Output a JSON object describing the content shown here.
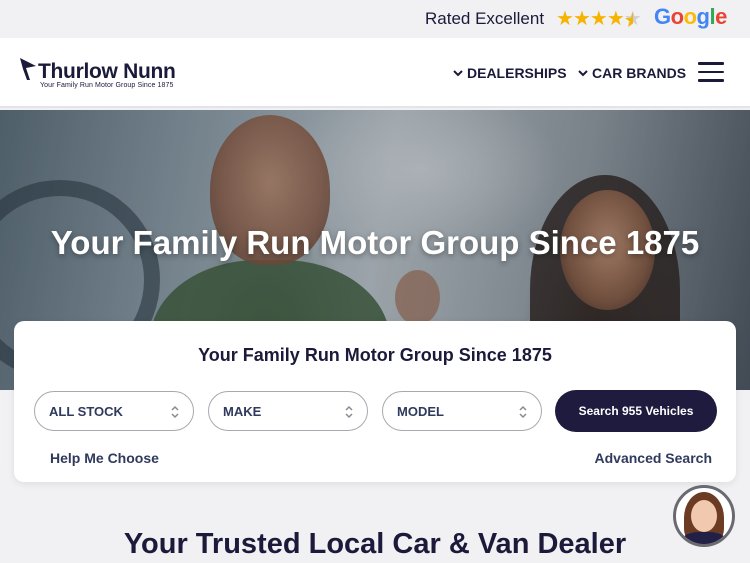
{
  "rating": {
    "label": "Rated Excellent",
    "stars_filled": 4.5,
    "stars_total": 5,
    "provider": "Google",
    "provider_letters": [
      {
        "char": "G",
        "color": "#4285F4"
      },
      {
        "char": "o",
        "color": "#EA4335"
      },
      {
        "char": "o",
        "color": "#FBBC05"
      },
      {
        "char": "g",
        "color": "#4285F4"
      },
      {
        "char": "l",
        "color": "#34A853"
      },
      {
        "char": "e",
        "color": "#EA4335"
      }
    ]
  },
  "header": {
    "logo_name": "Thurlow Nunn",
    "logo_tagline": "Your Family Run Motor Group Since 1875",
    "nav": {
      "dealerships": "DEALERSHIPS",
      "car_brands": "CAR BRANDS"
    }
  },
  "hero": {
    "title": "Your Family Run Motor Group Since 1875"
  },
  "search": {
    "title": "Your Family Run Motor Group Since 1875",
    "stock_select": "ALL STOCK",
    "make_select": "MAKE",
    "model_select": "MODEL",
    "button": "Search 955 Vehicles",
    "help_link": "Help Me Choose",
    "advanced_link": "Advanced Search"
  },
  "section": {
    "title": "Your Trusted Local Car & Van Dealer"
  },
  "colors": {
    "brand_navy": "#1e1b3f",
    "star_gold": "#f6b400",
    "page_bg": "#f1f1f3"
  }
}
